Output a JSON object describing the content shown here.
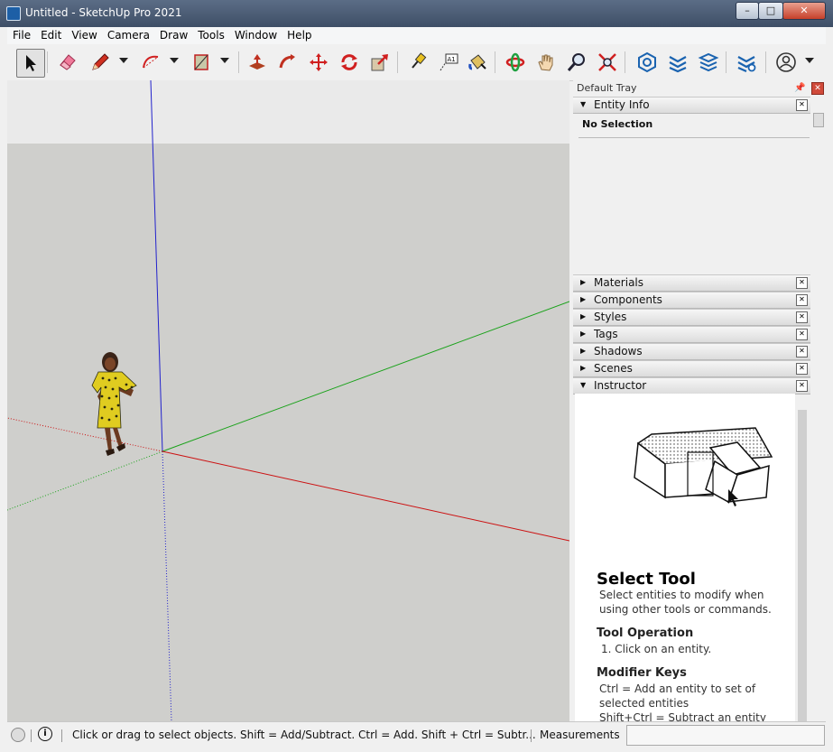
{
  "window": {
    "title": "Untitled - SketchUp Pro 2021",
    "controls": {
      "minimize": "–",
      "maximize": "□",
      "close": "✕"
    }
  },
  "menu": [
    "File",
    "Edit",
    "View",
    "Camera",
    "Draw",
    "Tools",
    "Window",
    "Help"
  ],
  "toolbar": {
    "tools": [
      "select-tool",
      "eraser-tool",
      "line-tool",
      "arc-tool",
      "rectangle-tool",
      "push-pull-tool",
      "follow-me-tool",
      "move-tool",
      "rotate-tool",
      "scale-tool",
      "tape-measure-tool",
      "text-tool",
      "paint-bucket-tool",
      "orbit-tool",
      "pan-tool",
      "zoom-tool",
      "zoom-extents-tool",
      "3d-warehouse-tool",
      "extension-warehouse-tool",
      "layout-tool",
      "extension-manager-tool",
      "account-tool"
    ],
    "text_tool_label": "A1"
  },
  "tray": {
    "title": "Default Tray",
    "entity_info": {
      "label": "Entity Info",
      "selection_text": "No Selection"
    },
    "panels": [
      "Materials",
      "Components",
      "Styles",
      "Tags",
      "Shadows",
      "Scenes"
    ],
    "instructor": {
      "label": "Instructor",
      "heading": "Select Tool",
      "description": "Select entities to modify when using other tools or commands.",
      "operation_heading": "Tool Operation",
      "operation_text": "1. Click on an entity.",
      "modifier_heading": "Modifier Keys",
      "modifier_ctrl": "Ctrl = Add an entity to set of selected entities",
      "modifier_shift_ctrl": "Shift+Ctrl = Subtract an entity"
    }
  },
  "status": {
    "message": "Click or drag to select objects. Shift = Add/Subtract. Ctrl = Add. Shift + Ctrl = Subtr...",
    "measurements_label": "Measurements",
    "measurements_value": ""
  },
  "colors": {
    "sky": "#eaeaea",
    "ground": "#cfcfcc",
    "red_axis": "#cc1111",
    "green_axis": "#1aa21a",
    "blue_axis": "#2222cc",
    "tray_bg": "#f0f0f0"
  }
}
